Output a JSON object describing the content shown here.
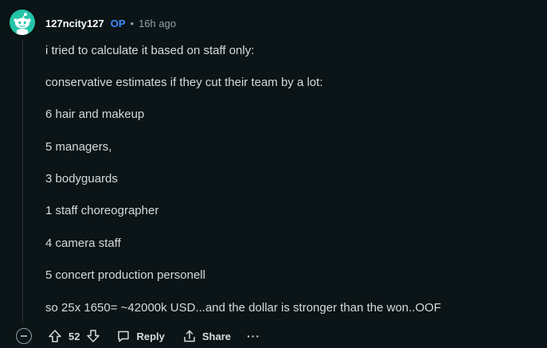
{
  "comment": {
    "author": "127ncity127",
    "op_badge": "OP",
    "separator": "•",
    "time": "16h ago",
    "paragraphs": [
      "i tried to calculate it based on staff only:",
      "conservative estimates if they cut their team by a lot:",
      "6 hair and makeup",
      "5 managers,",
      "3 bodyguards",
      "1 staff choreographer",
      "4 camera staff",
      "5 concert production personell",
      "so 25x 1650= ~42000k USD...and the dollar is stronger than the won..OOF"
    ],
    "votes": "52",
    "actions": {
      "reply": "Reply",
      "share": "Share",
      "more": "···"
    }
  },
  "colors": {
    "background": "#0b1416",
    "text": "#d7dadc",
    "op": "#3d8bff",
    "muted": "#8ea3ad",
    "avatar": "#24c4a8"
  },
  "icons": [
    "collapse-icon",
    "upvote-icon",
    "downvote-icon",
    "reply-icon",
    "share-icon",
    "more-icon",
    "snoo-avatar-icon"
  ]
}
